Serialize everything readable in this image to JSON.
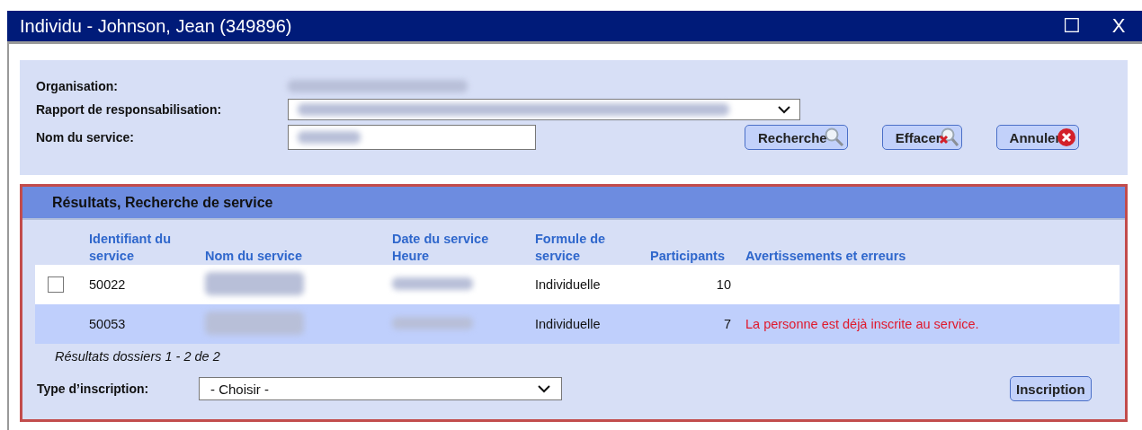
{
  "window": {
    "title": "Individu - Johnson, Jean (349896)",
    "controls": [
      "☐",
      "X"
    ]
  },
  "search": {
    "fields": [
      {
        "label": "Organisation:",
        "kind": "text"
      },
      {
        "label": "Rapport de responsabilisation:",
        "kind": "select"
      },
      {
        "label": "Nom du service:",
        "kind": "input"
      }
    ],
    "buttons": [
      "Recherche",
      "Effacer",
      "Annuler"
    ]
  },
  "results": {
    "title": "Résultats, Recherche de service",
    "columns": [
      "Identifiant du service",
      "Nom du service",
      "Date du service Heure",
      "Formule de service",
      "Participants",
      "Avertissements et erreurs"
    ],
    "rows": [
      {
        "kind": "checkbox",
        "checked": false,
        "selected": false,
        "id": "50022",
        "formule": "Individuelle",
        "participants": "10"
      },
      {
        "kind": "plain",
        "selected": true,
        "id": "50053",
        "formule": "Individuelle",
        "participants": "7",
        "warning": "La personne est déjà inscrite au service."
      }
    ],
    "summary": "Résultats dossiers 1 - 2 de 2",
    "enrol_type": {
      "label": "Type d’inscription:",
      "value": "- Choisir -"
    },
    "submit": "Inscription"
  }
}
